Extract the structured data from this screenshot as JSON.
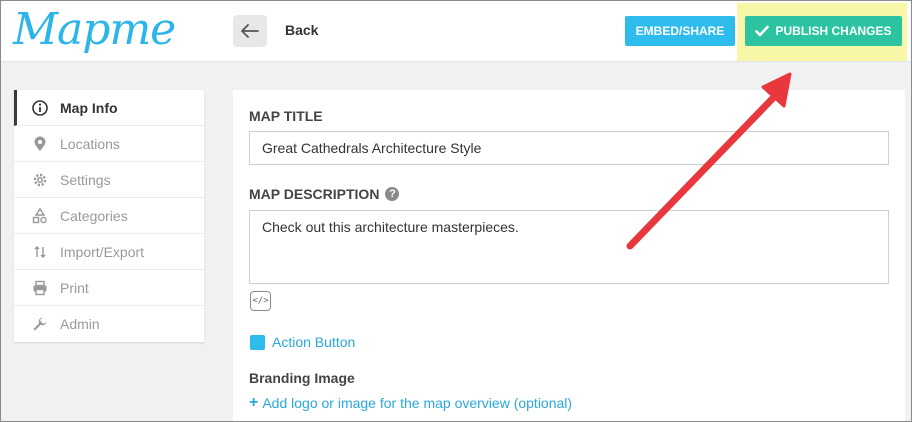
{
  "header": {
    "logo": "Mapme",
    "back_label": "Back",
    "embed_label": "EMBED/SHARE",
    "publish_label": "PUBLISH CHANGES"
  },
  "sidebar": {
    "items": [
      {
        "label": "Map Info",
        "icon": "info-icon",
        "active": true
      },
      {
        "label": "Locations",
        "icon": "map-pin-icon"
      },
      {
        "label": "Settings",
        "icon": "gear-icon"
      },
      {
        "label": "Categories",
        "icon": "shapes-icon"
      },
      {
        "label": "Import/Export",
        "icon": "import-export-icon"
      },
      {
        "label": "Print",
        "icon": "printer-icon"
      },
      {
        "label": "Admin",
        "icon": "wrench-icon"
      }
    ]
  },
  "form": {
    "map_title_label": "MAP TITLE",
    "map_title_value": "Great Cathedrals Architecture Style",
    "map_description_label": "MAP DESCRIPTION",
    "help_glyph": "?",
    "map_description_value": "Check out this architecture masterpieces.",
    "code_glyph": "</>",
    "action_button_label": "Action Button",
    "branding_label": "Branding Image",
    "add_logo_plus": "+",
    "add_logo_label": "Add logo or image for the map overview (optional)"
  },
  "colors": {
    "brand": "#2bb5e8",
    "embed": "#2ebcec",
    "publish": "#2cc4a0",
    "highlight": "#f8f7a8",
    "annotation_arrow": "#e8383d"
  }
}
